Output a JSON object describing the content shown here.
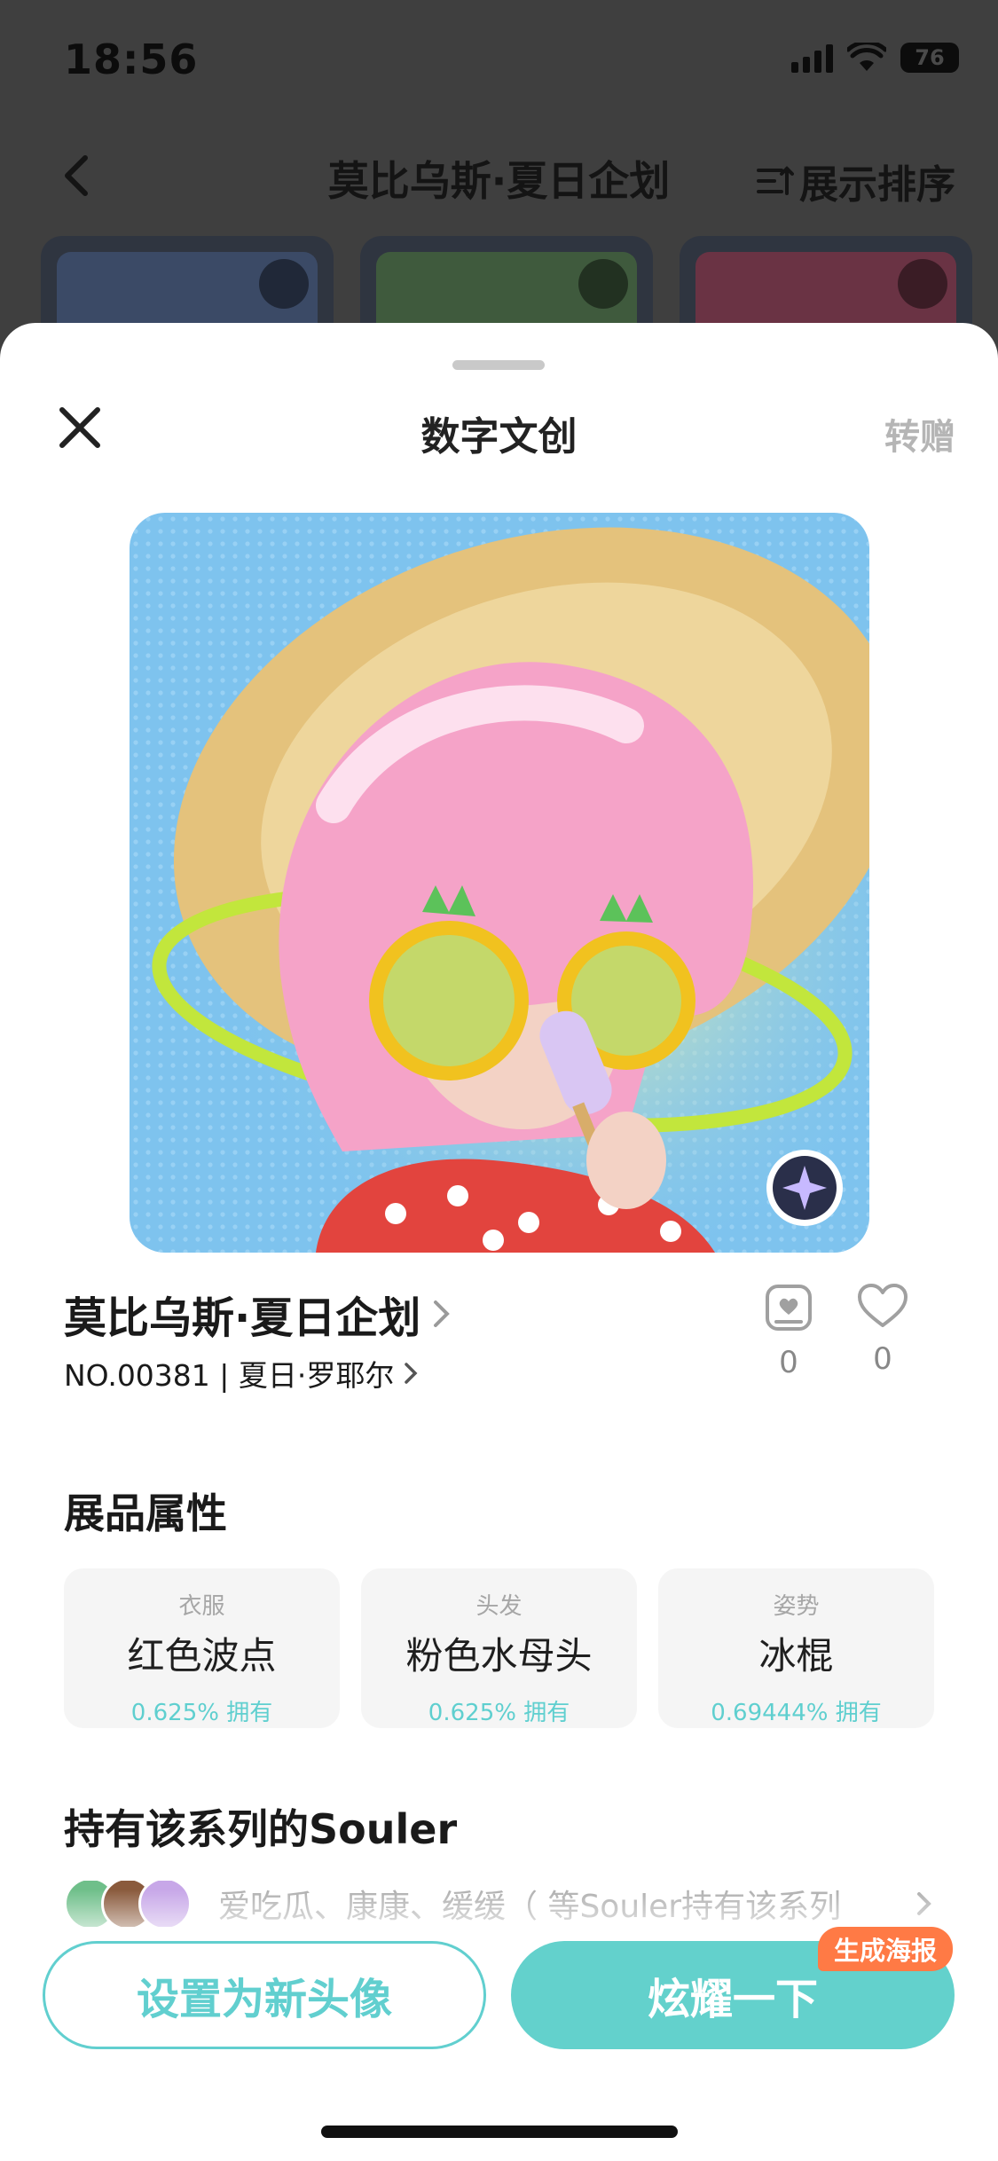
{
  "status_bar": {
    "time": "18:56",
    "battery": "76"
  },
  "background_page": {
    "title": "莫比乌斯·夏日企划",
    "sort_label": "展示排序",
    "card_colors": [
      "#3b4a66",
      "#3f5a3d",
      "#6a3344"
    ]
  },
  "sheet": {
    "title": "数字文创",
    "gift_label": "转赠"
  },
  "artwork": {
    "background_color": "#7ec3ee",
    "subject": "pink-jellyfish-hair-girl-with-straw-hat-and-popsicle"
  },
  "item": {
    "title": "莫比乌斯·夏日企划",
    "subtitle": "NO.00381 | 夏日·罗耶尔",
    "collect_count": "0",
    "like_count": "0"
  },
  "attributes": {
    "section_title": "展品属性",
    "items": [
      {
        "category": "衣服",
        "value": "红色波点",
        "percent": "0.625% 拥有"
      },
      {
        "category": "头发",
        "value": "粉色水母头",
        "percent": "0.625% 拥有"
      },
      {
        "category": "姿势",
        "value": "冰棍",
        "percent": "0.69444% 拥有"
      }
    ]
  },
  "owners": {
    "section_title": "持有该系列的Souler",
    "summary": "爱吃瓜、康康、缓缓（ 等Souler持有该系列"
  },
  "actions": {
    "set_avatar": "设置为新头像",
    "show_off": "炫耀一下",
    "poster_tag": "生成海报"
  },
  "colors": {
    "accent": "#61cfcf",
    "tag": "#ff7a45"
  }
}
